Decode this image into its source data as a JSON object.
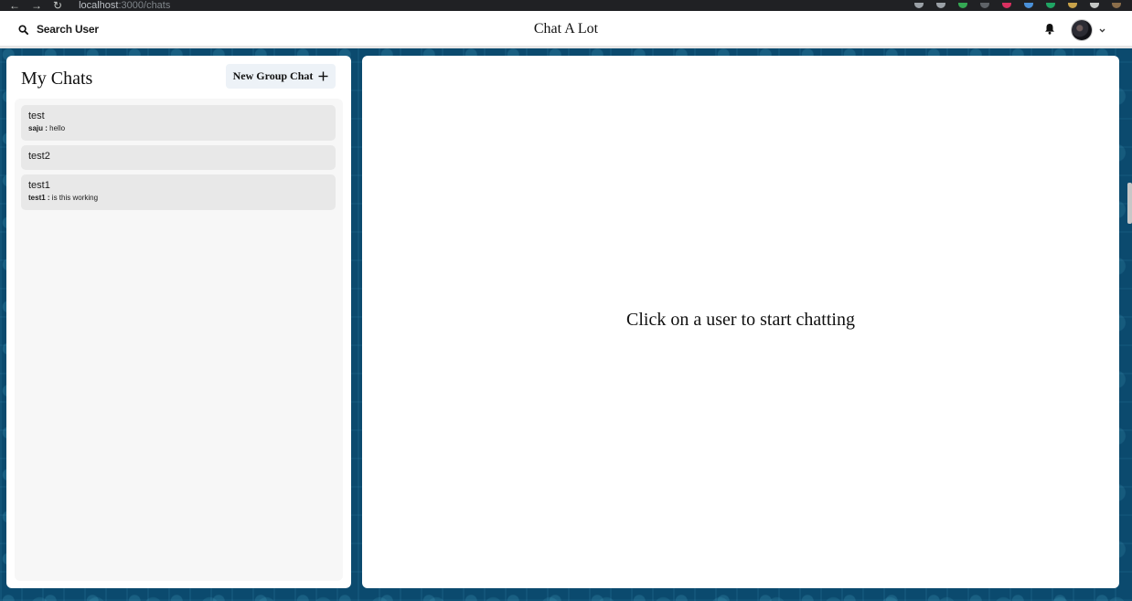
{
  "browser": {
    "url_host": "localhost",
    "url_rest": ":3000/chats",
    "colors": {
      "bar": "#202124"
    }
  },
  "header": {
    "search_label": "Search User",
    "app_title": "Chat A Lot",
    "icons": {
      "search": "search-icon",
      "bell": "bell-icon",
      "menu": "chevron-down-icon"
    }
  },
  "sidebar": {
    "title": "My Chats",
    "new_group_label": "New Group Chat",
    "chats": [
      {
        "name": "test",
        "sender": "saju :",
        "message": "hello"
      },
      {
        "name": "test2"
      },
      {
        "name": "test1",
        "sender": "test1 :",
        "message": "is this working"
      }
    ]
  },
  "main": {
    "placeholder": "Click on a user to start chatting"
  },
  "colors": {
    "background": "#0b4a6e",
    "panel": "#ffffff",
    "chat_item": "#e8e8e8",
    "button": "#edf2f7"
  }
}
